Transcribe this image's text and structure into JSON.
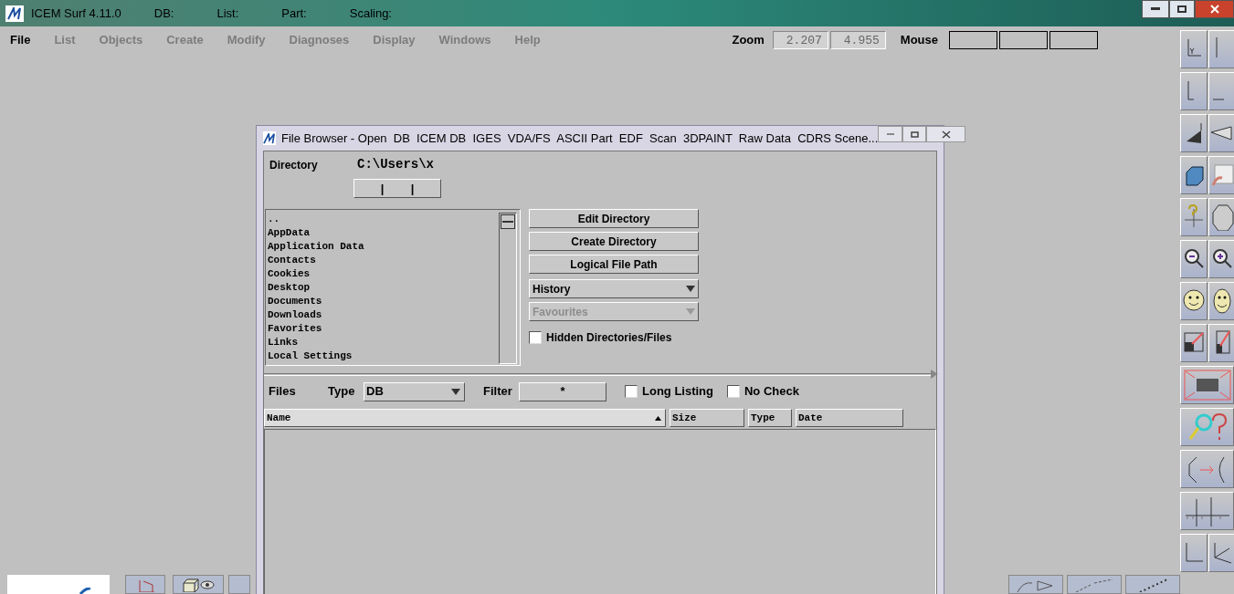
{
  "app_title_bar": {
    "title": "ICEM Surf 4.11.0",
    "fields": [
      "DB:",
      "List:",
      "Part:",
      "Scaling:"
    ]
  },
  "menu": [
    {
      "label": "File",
      "disabled": false
    },
    {
      "label": "List",
      "disabled": true
    },
    {
      "label": "Objects",
      "disabled": true
    },
    {
      "label": "Create",
      "disabled": true
    },
    {
      "label": "Modify",
      "disabled": true
    },
    {
      "label": "Diagnoses",
      "disabled": true
    },
    {
      "label": "Display",
      "disabled": true
    },
    {
      "label": "Windows",
      "disabled": true
    },
    {
      "label": "Help",
      "disabled": true
    }
  ],
  "zoom": {
    "label": "Zoom",
    "values": [
      "2.207",
      "4.955"
    ]
  },
  "mouse": {
    "label": "Mouse"
  },
  "file_browser": {
    "title": "File Browser - Open  DB  ICEM DB  IGES  VDA/FS  ASCII Part  EDF  Scan  3DPAINT  Raw Data  CDRS Scene...",
    "directory_label": "Directory",
    "directory_value": "C:\\Users\\x",
    "path_marks": [
      "|",
      "|"
    ],
    "directories": [
      "..",
      "AppData",
      "Application Data",
      "Contacts",
      "Cookies",
      "Desktop",
      "Documents",
      "Downloads",
      "Favorites",
      "Links",
      "Local Settings"
    ],
    "buttons": [
      "Edit Directory",
      "Create Directory",
      "Logical File Path"
    ],
    "dropdowns": [
      {
        "label": "History",
        "disabled": false
      },
      {
        "label": "Favourites",
        "disabled": true
      }
    ],
    "hidden_files": {
      "label": "Hidden Directories/Files",
      "checked": false
    },
    "files_label": "Files",
    "type": {
      "label": "Type",
      "value": "DB"
    },
    "filter": {
      "label": "Filter",
      "value": "*"
    },
    "options": [
      {
        "label": "Long Listing",
        "checked": false
      },
      {
        "label": "No Check",
        "checked": false
      }
    ],
    "columns": [
      {
        "label": "Name",
        "sorted": true
      },
      {
        "label": "Size",
        "sorted": false
      },
      {
        "label": "Type",
        "sorted": false
      },
      {
        "label": "Date",
        "sorted": false
      }
    ]
  }
}
